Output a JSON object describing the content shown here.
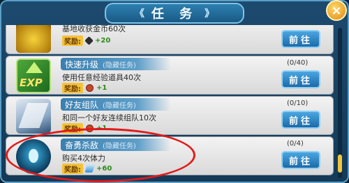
{
  "window": {
    "title": "任 务",
    "title_deco_left": "《",
    "title_deco_right": "》",
    "close_label": "×"
  },
  "tasks": [
    {
      "name": "",
      "hidden_tag": "",
      "desc": "基地收获金币60次",
      "reward_label": "奖励:",
      "reward_icon": "coin-icon",
      "reward_amount": "+20",
      "progress": "",
      "button": "前往"
    },
    {
      "name": "快速升级",
      "hidden_tag": "(隐藏任务)",
      "desc": "使用任意经验道具40次",
      "reward_label": "奖励:",
      "reward_icon": "ticket-icon",
      "reward_amount": "+1",
      "progress": "(0/40)",
      "button": "前往"
    },
    {
      "name": "好友组队",
      "hidden_tag": "(隐藏任务)",
      "desc": "和同一个好友连续组队10次",
      "reward_label": "奖励:",
      "reward_icon": "ticket-icon",
      "reward_amount": "+1",
      "progress": "(0/10)",
      "button": "前往"
    },
    {
      "name": "奋勇杀敌",
      "hidden_tag": "(隐藏任务)",
      "desc": "购买4次体力",
      "reward_label": "奖励:",
      "reward_icon": "crystal-icon",
      "reward_amount": "+60",
      "progress": "(0/4)",
      "button": "前往"
    }
  ],
  "colors": {
    "highlight": "#e21a1a",
    "button": "#1c6aa8",
    "reward_amount": "#2a8a18"
  }
}
